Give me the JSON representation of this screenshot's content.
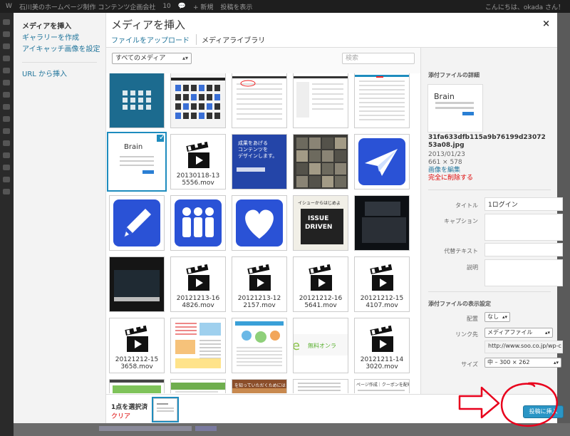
{
  "admin_bar": {
    "site_name": "石川美のホームページ制作 コンテンツ企画会社",
    "updates": "10",
    "new_label": "+ 新規",
    "view_post": "投稿を表示",
    "greeting": "こんにちは、okada さん！"
  },
  "modal": {
    "title": "メディアを挿入",
    "close_glyph": "×",
    "menu": [
      "メディアを挿入",
      "ギャラリーを作成",
      "アイキャッチ画像を設定",
      "URL から挿入"
    ],
    "tabs": [
      "ファイルをアップロード",
      "メディアライブラリ"
    ]
  },
  "toolbar": {
    "filter_value": "すべてのメディア",
    "search_placeholder": "検索"
  },
  "grid": {
    "thumbnails": [
      {
        "kind": "image",
        "style": "blue-icons"
      },
      {
        "kind": "image",
        "style": "screenshot-grid"
      },
      {
        "kind": "image",
        "style": "screenshot-table"
      },
      {
        "kind": "image",
        "style": "screenshot-plain"
      },
      {
        "kind": "image",
        "style": "screenshot-brain"
      },
      {
        "kind": "image",
        "style": "brain-login",
        "selected": true
      },
      {
        "kind": "video",
        "label": "20130118-135556.mov"
      },
      {
        "kind": "image",
        "style": "blue-poster"
      },
      {
        "kind": "image",
        "style": "photo-dark"
      },
      {
        "kind": "icon",
        "glyph": "paper-plane"
      },
      {
        "kind": "icon",
        "glyph": "pencil"
      },
      {
        "kind": "icon",
        "glyph": "people"
      },
      {
        "kind": "icon",
        "glyph": "heart"
      },
      {
        "kind": "image",
        "style": "book-issue"
      },
      {
        "kind": "image",
        "style": "photo-laptop"
      },
      {
        "kind": "image",
        "style": "photo-laptop2"
      },
      {
        "kind": "video",
        "label": "20121213-164826.mov"
      },
      {
        "kind": "video",
        "label": "20121213-122157.mov"
      },
      {
        "kind": "video",
        "label": "20121212-165641.mov"
      },
      {
        "kind": "video",
        "label": "20121212-154107.mov"
      },
      {
        "kind": "video",
        "label": "20121212-153658.mov"
      },
      {
        "kind": "image",
        "style": "infographic-a"
      },
      {
        "kind": "image",
        "style": "infographic-b"
      },
      {
        "kind": "image",
        "style": "banner-online"
      },
      {
        "kind": "video",
        "label": "20121211-143020.mov"
      },
      {
        "kind": "image",
        "style": "partial-green"
      },
      {
        "kind": "image",
        "style": "partial-green2"
      },
      {
        "kind": "image",
        "style": "partial-sunset"
      },
      {
        "kind": "image",
        "style": "partial-text"
      },
      {
        "kind": "image",
        "style": "partial-coupon"
      }
    ],
    "book_text": {
      "line1": "イシューからはじめよ",
      "line2": "ISSUE",
      "line3": "DRIVEN"
    },
    "poster_text": [
      "成果をあげる",
      "コンテンツを",
      "デザインします。"
    ],
    "banner_text": "無料オンラ",
    "partial_sunset_text": "を知っていただくためには",
    "partial_coupon_text": "ページ作成｜クーポンを配布できます"
  },
  "attachment": {
    "heading": "添付ファイルの詳細",
    "thumb_text": "Brain",
    "filename": "31fa633dfb115a9b76199d2307253a08.jpg",
    "date": "2013/01/23",
    "dimensions": "661 × 578",
    "edit_link": "画像を編集",
    "delete_link": "完全に削除する",
    "fields": {
      "title_label": "タイトル",
      "title_value": "1ログイン",
      "caption_label": "キャプション",
      "alt_label": "代替テキスト",
      "desc_label": "説明"
    },
    "display": {
      "heading": "添付ファイルの表示設定",
      "align_label": "配置",
      "align_value": "なし",
      "link_label": "リンク先",
      "link_value": "メディアファイル",
      "url_value": "http://www.soo.co.jp/wp-c",
      "size_label": "サイズ",
      "size_value": "中 – 300 × 262"
    }
  },
  "footer": {
    "selected_count": "1点を選択済",
    "clear_label": "クリア",
    "insert_button": "投稿に挿入"
  },
  "colors": {
    "accent": "#1e8cbe",
    "link": "#21759b",
    "danger": "#dd0000",
    "annotation": "#e8001c"
  }
}
